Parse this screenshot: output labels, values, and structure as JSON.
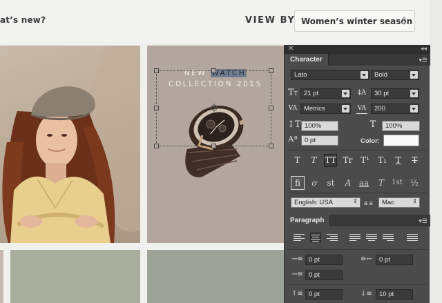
{
  "page": {
    "whats_new": "at’s new?",
    "view_by_label": "VIEW BY",
    "view_by_select": "Women’s winter season",
    "watch_tile": {
      "line1_before": "NEW ",
      "line1_highlight": "WATCH",
      "line2": "COLLECTION 2015"
    }
  },
  "panel": {
    "character_tab": "Character",
    "font_family": "Lato",
    "font_style": "Bold",
    "font_size": "21 pt",
    "leading": "30 pt",
    "kerning": "Metrics",
    "tracking": "200",
    "vertical_scale": "100%",
    "horizontal_scale": "100%",
    "baseline_shift": "0 pt",
    "color_label": "Color:",
    "language": "English: USA",
    "aa_icon_text": "a a",
    "antialias": "Mac",
    "paragraph_tab": "Paragraph",
    "indent_left": "0 pt",
    "indent_right": "0 pt",
    "indent_first": "0 pt",
    "space_before": "0 pt",
    "space_after": "10 pt",
    "type_buttons": [
      "T",
      "T",
      "TT",
      "Tr",
      "T¹",
      "T₁",
      "T",
      "T"
    ],
    "opentype_buttons": [
      "fi",
      "ơ",
      "st",
      "A",
      "aa",
      "T",
      "1st",
      "½"
    ]
  },
  "colors": {
    "panel_bg": "#4b4b4b",
    "highlight": "#6f7c8f"
  }
}
